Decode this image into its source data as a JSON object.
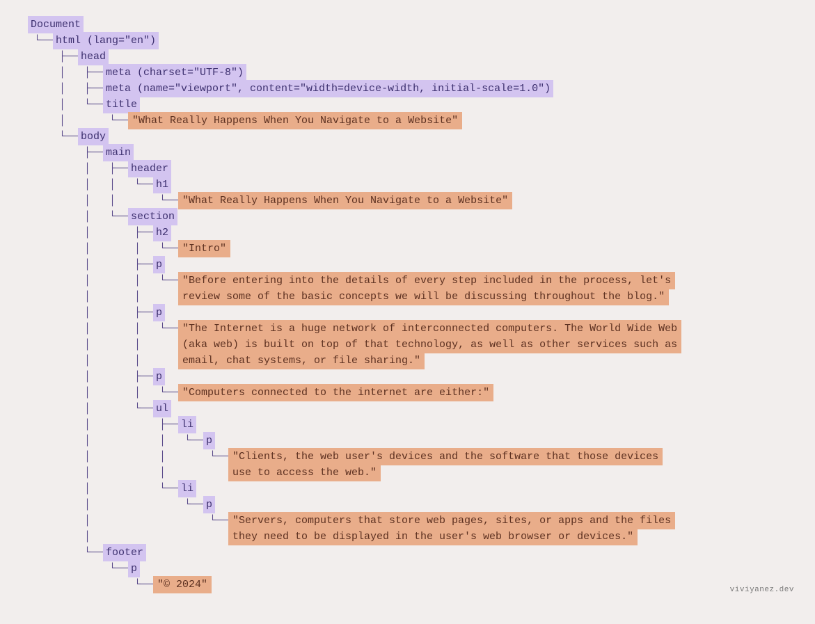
{
  "watermark": "viviyanez.dev",
  "nodes": [
    {
      "branches": [],
      "kind": "tag",
      "label": "Document"
    },
    {
      "branches": [
        " └── "
      ],
      "kind": "tag",
      "label": "html (lang=\"en\")"
    },
    {
      "branches": [
        "     ",
        " ├── "
      ],
      "kind": "tag",
      "label": "head"
    },
    {
      "branches": [
        "     ",
        " │   ",
        " ├── "
      ],
      "kind": "tag",
      "label": "meta (charset=\"UTF-8\")"
    },
    {
      "branches": [
        "     ",
        " │   ",
        " ├── "
      ],
      "kind": "tag",
      "label": "meta (name=\"viewport\", content=\"width=device-width, initial-scale=1.0\")"
    },
    {
      "branches": [
        "     ",
        " │   ",
        " └── "
      ],
      "kind": "tag",
      "label": "title"
    },
    {
      "branches": [
        "     ",
        " │   ",
        "     ",
        " └── "
      ],
      "kind": "text",
      "label": "\"What Really Happens When You Navigate to a Website\""
    },
    {
      "branches": [
        "     ",
        " └── "
      ],
      "kind": "tag",
      "label": "body"
    },
    {
      "branches": [
        "     ",
        "     ",
        " ├── "
      ],
      "kind": "tag",
      "label": "main"
    },
    {
      "branches": [
        "     ",
        "     ",
        " │   ",
        " ├── "
      ],
      "kind": "tag",
      "label": "header"
    },
    {
      "branches": [
        "     ",
        "     ",
        " │   ",
        " │   ",
        " └── "
      ],
      "kind": "tag",
      "label": "h1"
    },
    {
      "branches": [
        "     ",
        "     ",
        " │   ",
        " │   ",
        "     ",
        " └── "
      ],
      "kind": "text",
      "label": "\"What Really Happens When You Navigate to a Website\""
    },
    {
      "branches": [
        "     ",
        "     ",
        " │   ",
        " └── "
      ],
      "kind": "tag",
      "label": "section"
    },
    {
      "branches": [
        "     ",
        "     ",
        " │   ",
        "     ",
        " ├── "
      ],
      "kind": "tag",
      "label": "h2"
    },
    {
      "branches": [
        "     ",
        "     ",
        " │   ",
        "     ",
        " │   ",
        " └── "
      ],
      "kind": "text",
      "label": "\"Intro\""
    },
    {
      "branches": [
        "     ",
        "     ",
        " │   ",
        "     ",
        " ├── "
      ],
      "kind": "tag",
      "label": "p"
    },
    {
      "branches": [
        "     ",
        "     ",
        " │   ",
        "     ",
        " │   ",
        " └── "
      ],
      "kind": "text",
      "label": "\"Before entering into the details of every step included in the process, let's"
    },
    {
      "branches": [
        "     ",
        "     ",
        " │   ",
        "     ",
        " │   ",
        "     "
      ],
      "kind": "text",
      "label": " review some of the basic concepts we will be discussing throughout the blog.\""
    },
    {
      "branches": [
        "     ",
        "     ",
        " │   ",
        "     ",
        " ├── "
      ],
      "kind": "tag",
      "label": "p"
    },
    {
      "branches": [
        "     ",
        "     ",
        " │   ",
        "     ",
        " │   ",
        " └── "
      ],
      "kind": "text",
      "label": "\"The Internet is a huge network of interconnected computers. The World Wide Web "
    },
    {
      "branches": [
        "     ",
        "     ",
        " │   ",
        "     ",
        " │   ",
        "     "
      ],
      "kind": "text",
      "label": "(aka web) is built on top of that technology, as well as other services such as"
    },
    {
      "branches": [
        "     ",
        "     ",
        " │   ",
        "     ",
        " │   ",
        "     "
      ],
      "kind": "text",
      "label": " email, chat systems, or file sharing.\""
    },
    {
      "branches": [
        "     ",
        "     ",
        " │   ",
        "     ",
        " ├── "
      ],
      "kind": "tag",
      "label": "p"
    },
    {
      "branches": [
        "     ",
        "     ",
        " │   ",
        "     ",
        " │   ",
        " └── "
      ],
      "kind": "text",
      "label": "\"Computers connected to the internet are either:\""
    },
    {
      "branches": [
        "     ",
        "     ",
        " │   ",
        "     ",
        " └── "
      ],
      "kind": "tag",
      "label": "ul"
    },
    {
      "branches": [
        "     ",
        "     ",
        " │   ",
        "     ",
        "     ",
        " ├── "
      ],
      "kind": "tag",
      "label": "li"
    },
    {
      "branches": [
        "     ",
        "     ",
        " │   ",
        "     ",
        "     ",
        " │   ",
        " └── "
      ],
      "kind": "tag",
      "label": "p"
    },
    {
      "branches": [
        "     ",
        "     ",
        " │   ",
        "     ",
        "     ",
        " │   ",
        "     ",
        " └── "
      ],
      "kind": "text",
      "label": "\"Clients, the web user's devices and the software that those devices "
    },
    {
      "branches": [
        "     ",
        "     ",
        " │   ",
        "     ",
        "     ",
        " │   ",
        "     ",
        "     "
      ],
      "kind": "text",
      "label": "use to access the web.\""
    },
    {
      "branches": [
        "     ",
        "     ",
        " │   ",
        "     ",
        "     ",
        " └── "
      ],
      "kind": "tag",
      "label": "li"
    },
    {
      "branches": [
        "     ",
        "     ",
        " │   ",
        "     ",
        "     ",
        "     ",
        " └── "
      ],
      "kind": "tag",
      "label": "p"
    },
    {
      "branches": [
        "     ",
        "     ",
        " │   ",
        "     ",
        "     ",
        "     ",
        "     ",
        " └── "
      ],
      "kind": "text",
      "label": "\"Servers, computers that store web pages, sites, or apps and the files "
    },
    {
      "branches": [
        "     ",
        "     ",
        " │   ",
        "     ",
        "     ",
        "     ",
        "     ",
        "     "
      ],
      "kind": "text",
      "label": "they need to be displayed in the user's web browser or devices.\""
    },
    {
      "branches": [
        "     ",
        "     ",
        " └── "
      ],
      "kind": "tag",
      "label": "footer"
    },
    {
      "branches": [
        "     ",
        "     ",
        "     ",
        " └── "
      ],
      "kind": "tag",
      "label": "p"
    },
    {
      "branches": [
        "     ",
        "     ",
        "     ",
        "     ",
        " └── "
      ],
      "kind": "text",
      "label": "\"© 2024\""
    }
  ],
  "branchUnitWidth": 36
}
